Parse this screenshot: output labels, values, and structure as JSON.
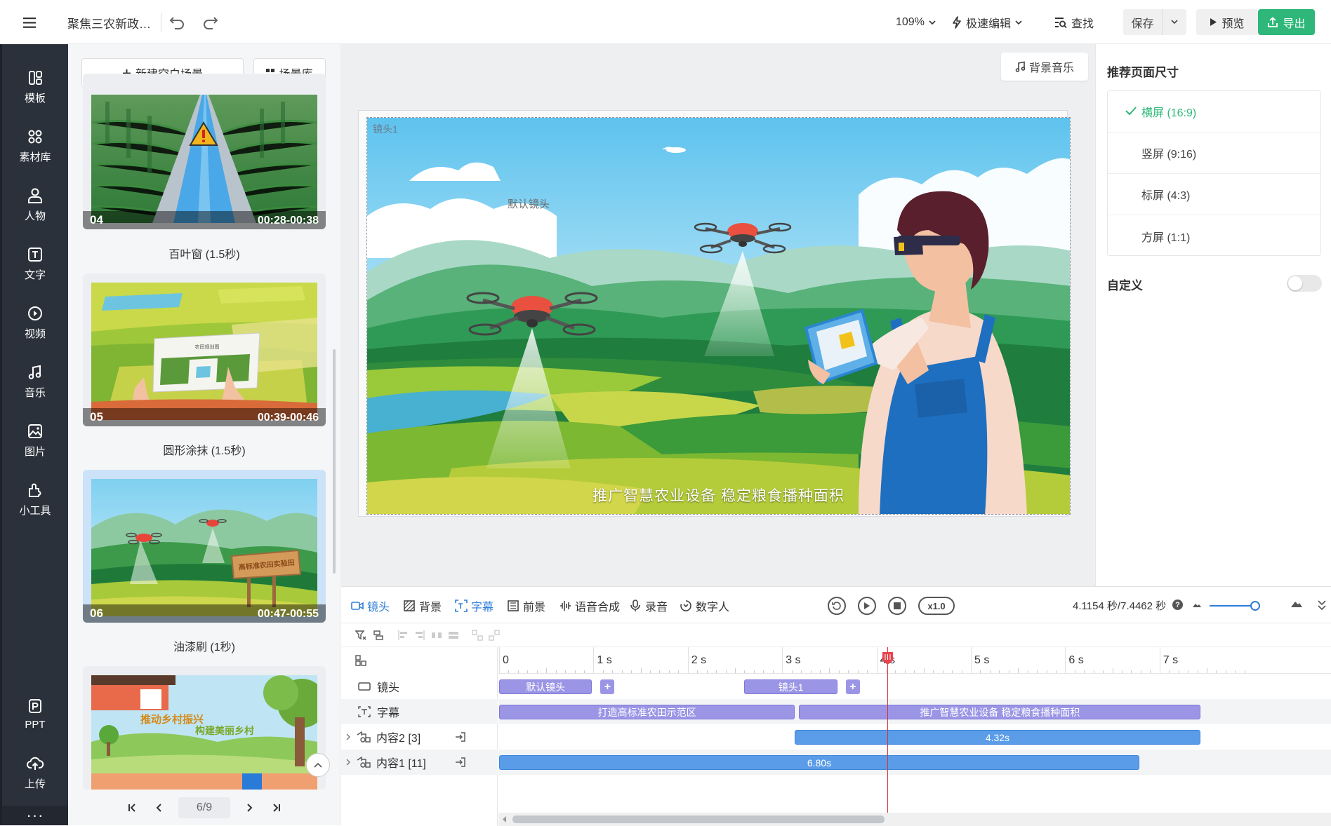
{
  "header": {
    "doc_title": "聚焦三农新政…",
    "zoom": "109%",
    "fast_edit": "极速编辑",
    "find": "查找",
    "save": "保存",
    "preview": "预览",
    "export": "导出",
    "accent_color": "#2eb779"
  },
  "sidebar": {
    "items": [
      {
        "label": "模板",
        "icon": "template-icon"
      },
      {
        "label": "素材库",
        "icon": "asset-library-icon"
      },
      {
        "label": "人物",
        "icon": "person-icon"
      },
      {
        "label": "文字",
        "icon": "text-icon"
      },
      {
        "label": "视频",
        "icon": "video-icon"
      },
      {
        "label": "音乐",
        "icon": "music-icon"
      },
      {
        "label": "图片",
        "icon": "image-icon"
      },
      {
        "label": "小工具",
        "icon": "tools-icon"
      }
    ],
    "bottom_items": [
      {
        "label": "PPT",
        "icon": "ppt-icon"
      },
      {
        "label": "上传",
        "icon": "upload-icon"
      }
    ],
    "more": "···"
  },
  "scene_panel": {
    "new_scene": "新建空白场景",
    "scene_library": "场景库",
    "scenes": [
      {
        "num": "04",
        "time": "00:28-00:38",
        "label": "百叶窗 (1.5秒)",
        "selected": false
      },
      {
        "num": "05",
        "time": "00:39-00:46",
        "label": "圆形涂抹 (1.5秒)",
        "selected": false
      },
      {
        "num": "06",
        "time": "00:47-00:55",
        "label": "油漆刷 (1秒)",
        "selected": true
      },
      {
        "num": "",
        "time": "",
        "label": "",
        "selected": false
      }
    ],
    "thumb_texts": {
      "map": "农田规划图",
      "sign": "高标准农田实验田",
      "village_line1": "推动乡村振兴",
      "village_line2": "构建美丽乡村"
    },
    "page": "6/9"
  },
  "canvas": {
    "bg_music": "背景音乐",
    "shot_label": "镜头1",
    "default_shot_label": "默认镜头",
    "subtitle": "推广智慧农业设备 稳定粮食播种面积"
  },
  "right_panel": {
    "title": "推荐页面尺寸",
    "options": [
      {
        "label": "横屏 (16:9)",
        "active": true
      },
      {
        "label": "竖屏 (9:16)",
        "active": false
      },
      {
        "label": "标屏 (4:3)",
        "active": false
      },
      {
        "label": "方屏 (1:1)",
        "active": false
      }
    ],
    "custom": "自定义",
    "custom_enabled": false
  },
  "timeline": {
    "tabs": [
      {
        "label": "镜头",
        "icon": "shot-icon",
        "active": true
      },
      {
        "label": "背景",
        "icon": "background-icon",
        "active": false
      },
      {
        "label": "字幕",
        "icon": "subtitle-icon",
        "active": true
      },
      {
        "label": "前景",
        "icon": "foreground-icon",
        "active": false
      },
      {
        "label": "语音合成",
        "icon": "voice-synthesis-icon",
        "active": false
      },
      {
        "label": "录音",
        "icon": "microphone-icon",
        "active": false
      },
      {
        "label": "数字人",
        "icon": "digital-human-icon",
        "active": false
      }
    ],
    "speed": "x1.0",
    "time_readout": "4.1154 秒/7.4462 秒",
    "zoom_level": 0.9,
    "ticks": [
      "0",
      "1 s",
      "2 s",
      "3 s",
      "4 s",
      "5 s",
      "6 s",
      "7 s"
    ],
    "tracks": [
      {
        "name": "镜头",
        "icon": "shot-icon"
      },
      {
        "name": "字幕",
        "icon": "subtitle-icon"
      },
      {
        "name": "内容2 [3]",
        "icon": "content-icon"
      },
      {
        "name": "内容1 [11]",
        "icon": "content-icon"
      }
    ],
    "shot_clips": [
      {
        "label": "默认镜头",
        "start": 0,
        "end": 1.0
      },
      {
        "label": "镜头1",
        "start": 2.6,
        "end": 3.6
      }
    ],
    "subtitle_clips": [
      {
        "label": "打造高标准农田示范区",
        "start": 0,
        "end": 3.15
      },
      {
        "label": "推广智慧农业设备 稳定粮食播种面积",
        "start": 3.18,
        "end": 7.45
      }
    ],
    "content2_clip": {
      "label": "4.32s",
      "start": 3.13,
      "end": 7.45
    },
    "content1_clip": {
      "label": "6.80s",
      "start": 0,
      "end": 6.8
    },
    "playhead": 4.1154
  }
}
